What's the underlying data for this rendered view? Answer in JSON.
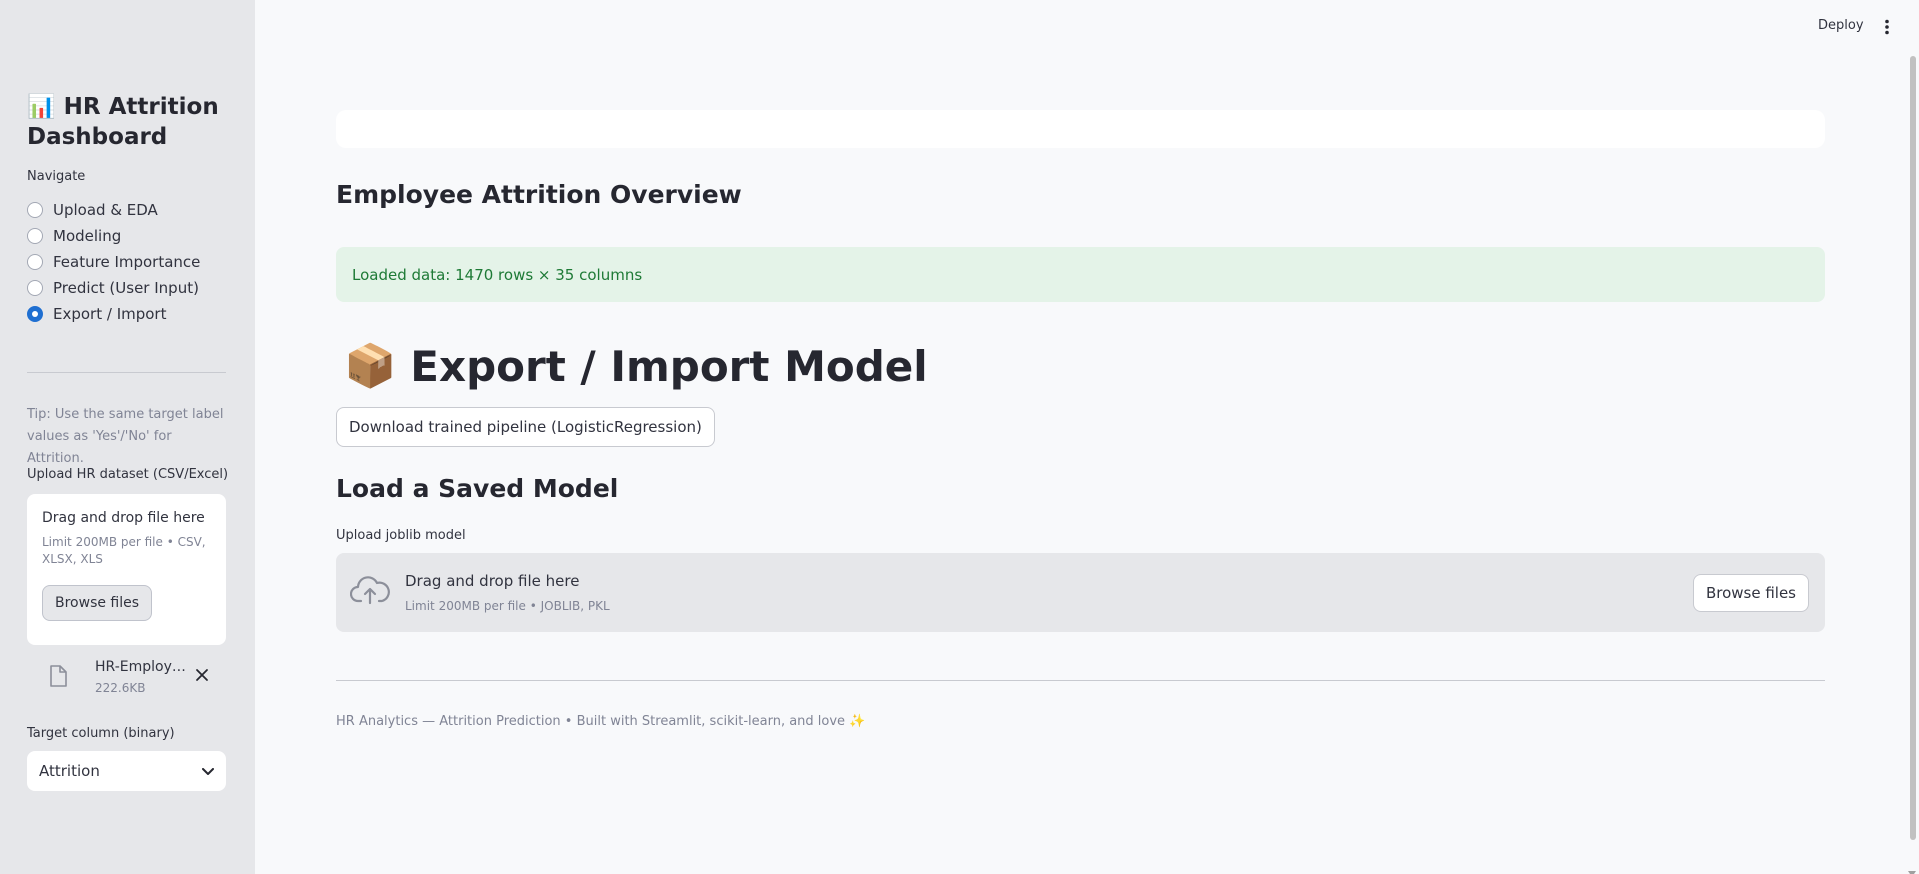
{
  "sidebar": {
    "title_emoji": "📊",
    "title": "HR Attrition Dashboard",
    "nav_label": "Navigate",
    "nav_items": [
      {
        "label": "Upload & EDA",
        "selected": false
      },
      {
        "label": "Modeling",
        "selected": false
      },
      {
        "label": "Feature Importance",
        "selected": false
      },
      {
        "label": "Predict (User Input)",
        "selected": false
      },
      {
        "label": "Export / Import",
        "selected": true
      }
    ],
    "tip": "Tip: Use the same target label values as 'Yes'/'No' for Attrition.",
    "upload_label": "Upload HR dataset (CSV/Excel)",
    "dropzone": {
      "title": "Drag and drop file here",
      "limit": "Limit 200MB per file • CSV, XLSX, XLS",
      "browse_label": "Browse files"
    },
    "uploaded_file": {
      "name": "HR-Employee-Attrition.csv",
      "size": "222.6KB"
    },
    "target_label": "Target column (binary)",
    "target_value": "Attrition"
  },
  "header": {
    "deploy_label": "Deploy"
  },
  "main": {
    "overview_title": "Employee Attrition Overview",
    "success_message": "Loaded data: 1470 rows × 35 columns",
    "export_emoji": "📦",
    "export_title": "Export / Import Model",
    "download_button": "Download trained pipeline (LogisticRegression)",
    "load_title": "Load a Saved Model",
    "joblib_label": "Upload joblib model",
    "dropzone": {
      "title": "Drag and drop file here",
      "limit": "Limit 200MB per file • JOBLIB, PKL",
      "browse_label": "Browse files"
    },
    "footer": "HR Analytics — Attrition Prediction • Built with Streamlit, scikit-learn, and love ✨"
  },
  "colors": {
    "accent": "#1f6fd1",
    "success_bg": "#e4f3e8",
    "success_text": "#1e7a36",
    "sidebar_bg": "#e6e7ea"
  }
}
